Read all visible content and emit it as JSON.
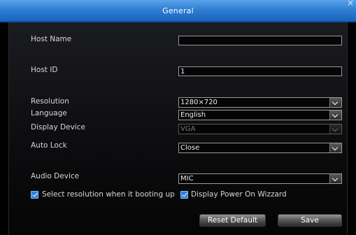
{
  "window": {
    "title": "General",
    "close_glyph": "×"
  },
  "fields": {
    "host_name": {
      "label": "Host Name",
      "value": ""
    },
    "host_id": {
      "label": "Host ID",
      "value": "1"
    },
    "resolution": {
      "label": "Resolution",
      "value": "1280×720"
    },
    "language": {
      "label": "Language",
      "value": "English"
    },
    "display_device": {
      "label": "Display Device",
      "value": "VGA"
    },
    "auto_lock": {
      "label": "Auto Lock",
      "value": "Close"
    },
    "audio_device": {
      "label": "Audio Device",
      "value": "MIC"
    }
  },
  "checkboxes": {
    "select_resolution": {
      "label": "Select resolution when it booting up",
      "checked": true
    },
    "display_wizard": {
      "label": "Display Power On Wizzard",
      "checked": true
    }
  },
  "buttons": {
    "reset": "Reset Default",
    "save": "Save"
  },
  "colors": {
    "title_bar": "#2f7fd3",
    "accent": "#2a7fd8",
    "background": "#0c0c0e"
  }
}
